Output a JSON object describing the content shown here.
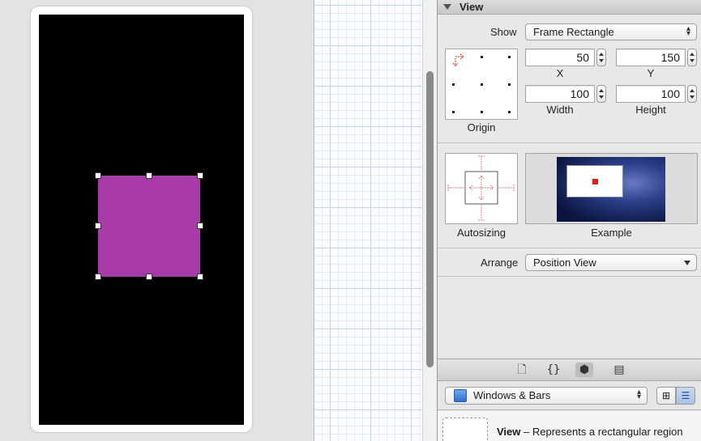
{
  "inspector": {
    "section_title": "View",
    "show_label": "Show",
    "show_value": "Frame Rectangle",
    "x_value": "50",
    "y_value": "150",
    "width_value": "100",
    "height_value": "100",
    "x_label": "X",
    "y_label": "Y",
    "width_label": "Width",
    "height_label": "Height",
    "origin_label": "Origin",
    "autosizing_label": "Autosizing",
    "example_label": "Example",
    "arrange_label": "Arrange",
    "arrange_value": "Position View"
  },
  "library": {
    "category_value": "Windows & Bars",
    "item_name": "View",
    "item_description": " – Represents a rectangular region"
  },
  "colors": {
    "subview": "#a93aa9",
    "screen": "#000000",
    "accent_red": "#e02020"
  },
  "icons": {
    "tabs": [
      "file-icon",
      "braces-icon",
      "cube-icon",
      "media-icon"
    ],
    "library_view_modes": [
      "grid-icon",
      "list-icon"
    ]
  }
}
